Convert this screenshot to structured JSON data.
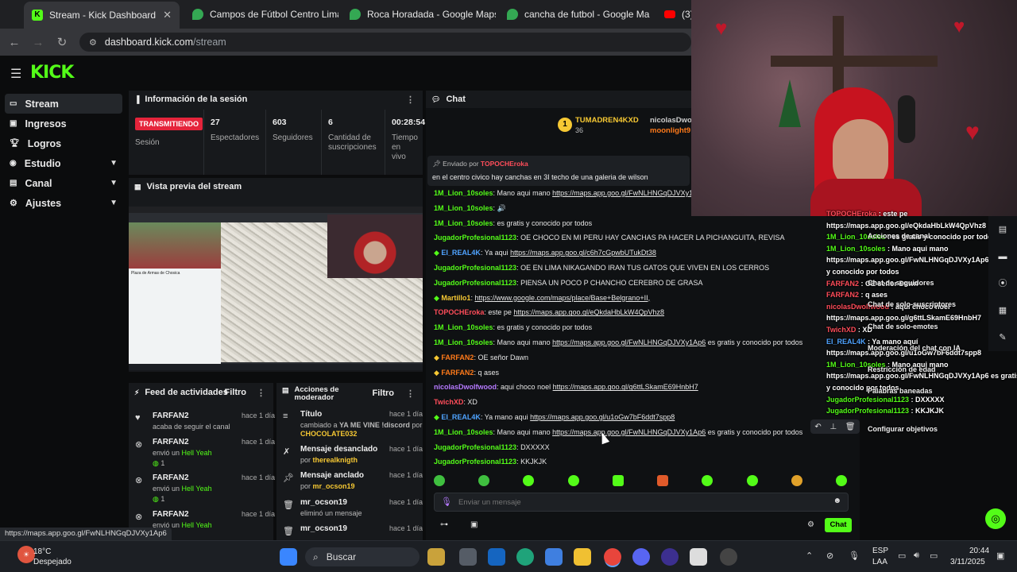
{
  "browser": {
    "tabs": [
      {
        "label": "Stream - Kick Dashboard",
        "active": true,
        "color": "#53fc18"
      },
      {
        "label": "Campos de Fútbol Centro Lima",
        "active": false,
        "color": "#34a853"
      },
      {
        "label": "Roca Horadada - Google Maps",
        "active": false,
        "color": "#34a853"
      },
      {
        "label": "cancha de futbol - Google Ma",
        "active": false,
        "color": "#34a853"
      },
      {
        "label": "(3)",
        "active": false,
        "color": "#ff0000"
      }
    ],
    "url_host": "dashboard.kick.com",
    "url_path": "/stream"
  },
  "kick": {
    "logo": "KICK",
    "sidebar": [
      {
        "label": "Stream",
        "icon": "monitor-icon",
        "active": true
      },
      {
        "label": "Ingresos",
        "icon": "money-icon"
      },
      {
        "label": "Logros",
        "icon": "trophy-icon"
      },
      {
        "label": "Estudio",
        "icon": "studio-icon",
        "chevron": true
      },
      {
        "label": "Canal",
        "icon": "channel-icon",
        "chevron": true
      },
      {
        "label": "Ajustes",
        "icon": "gear-icon",
        "chevron": true
      }
    ],
    "session": {
      "title": "Información de la sesión",
      "live_badge": "TRANSMITIENDO",
      "session_label": "Sesión",
      "viewers": "27",
      "viewers_label": "Espectadores",
      "followers": "603",
      "followers_label": "Seguidores",
      "subs": "6",
      "subs_label": "Cantidad de suscripciones",
      "time": "00:28:54",
      "time_label": "Tiempo en vivo"
    },
    "preview": {
      "title": "Vista previa del stream"
    },
    "feed": {
      "title": "Feed de actividades",
      "filter": "Filtro",
      "items": [
        {
          "name": "FARFAN2",
          "sub": "acaba de seguir el canal",
          "time": "hace 1 día",
          "icon": "heart-icon"
        },
        {
          "name": "FARFAN2",
          "sub_pre": "envió un",
          "sub_hl": "Hell Yeah",
          "count": "1",
          "time": "hace 1 día",
          "icon": "kick-icon"
        },
        {
          "name": "FARFAN2",
          "sub_pre": "envió un",
          "sub_hl": "Hell Yeah",
          "count": "1",
          "time": "hace 1 día",
          "icon": "kick-icon"
        },
        {
          "name": "FARFAN2",
          "sub_pre": "envió un",
          "sub_hl": "Hell Yeah",
          "time": "hace 1 día",
          "icon": "kick-icon"
        }
      ]
    },
    "modactions": {
      "title": "Acciones de moderador",
      "filter": "Filtro",
      "items": [
        {
          "title": "Título",
          "line1_pre": "cambiado a",
          "line1_hl": "YA ME VINE !discord",
          "line2_pre": "por",
          "line2_hl": "CHOCOLATE032",
          "time": "hace 1 día",
          "icon": "title-icon"
        },
        {
          "title": "Mensaje desanclado",
          "line1_pre": "por",
          "line1_hl": "therealknigth",
          "time": "hace 1 día",
          "icon": "unpin-icon"
        },
        {
          "title": "Mensaje anclado",
          "line1_pre": "por",
          "line1_hl": "mr_ocson19",
          "time": "hace 1 día",
          "icon": "pin-icon"
        },
        {
          "title": "mr_ocson19",
          "line1_pre": "eliminó un mensaje",
          "time": "hace 1 día",
          "icon": "trash-icon"
        },
        {
          "title": "mr_ocson19",
          "time": "hace 1 día",
          "icon": "trash-icon"
        }
      ]
    },
    "chat": {
      "title": "Chat",
      "top_user": "TUMADREN4KXD",
      "top_count": "36",
      "top_user2": "nicolasDwol",
      "top_user3": "moonlight9",
      "pinned_label_pre": "Enviado por",
      "pinned_by": "TOPOCHEroka",
      "pinned_text": "en el centro civico hay canchas en 3I techo de una galeria de wilson",
      "messages": [
        {
          "user": "1M_Lion_10soles",
          "color": "c-green",
          "text": "Mano aqui mano",
          "link": "https://maps.app.goo.gl/FwNLHNGqDJVXy1Ap6"
        },
        {
          "user": "1M_Lion_10soles",
          "color": "c-green",
          "text": "🔊"
        },
        {
          "user": "1M_Lion_10soles",
          "color": "c-green",
          "text": "es gratis y conocido por todos"
        },
        {
          "user": "JugadorProfesional1123",
          "color": "c-green",
          "text": "OE CHOCO EN MI PERU HAY CANCHAS PA HACER LA PICHANGUITA, REVISA"
        },
        {
          "user": "EI_REAL4K",
          "color": "c-blue",
          "badge": "c-green",
          "text": "Ya aqui",
          "link": "https://maps.app.goo.gl/c6h7cGpwbUTukDt38"
        },
        {
          "user": "JugadorProfesional1123",
          "color": "c-green",
          "text": "OE EN LIMA NIKAGANDO IRAN TUS GATOS QUE VIVEN EN LOS CERROS"
        },
        {
          "user": "JugadorProfesional1123",
          "color": "c-green",
          "text": "PIENSA UN POCO P CHANCHO CEREBRO DE GRASA"
        },
        {
          "user": "Martillo1",
          "color": "c-yellow",
          "badge": "c-green",
          "text": "",
          "link": "https://www.google.com/maps/place/Base+Belgrano+II,"
        },
        {
          "user": "TOPOCHEroka",
          "color": "c-red",
          "text": "este pe",
          "link": "https://maps.app.goo.gl/eQkdaHbLkW4QpVhz8"
        },
        {
          "user": "1M_Lion_10soles",
          "color": "c-green",
          "text": "es gratis y conocido por todos"
        },
        {
          "user": "1M_Lion_10soles",
          "color": "c-green",
          "text": "Mano aqui mano",
          "link": "https://maps.app.goo.gl/FwNLHNGqDJVXy1Ap6",
          "after": "es gratis y conocido por todos"
        },
        {
          "user": "FARFAN2",
          "color": "c-orange",
          "badge": "c-yellow",
          "text": "OE señor Dawn"
        },
        {
          "user": "FARFAN2",
          "color": "c-orange",
          "badge": "c-yellow",
          "text": "q ases"
        },
        {
          "user": "nicolasDwolfwood",
          "color": "c-purple",
          "text": "aqui choco noel",
          "link": "https://maps.app.goo.gl/g6ttLSkamE69HnbH7"
        },
        {
          "user": "TwichXD",
          "color": "c-red",
          "text": "XD"
        },
        {
          "user": "EI_REAL4K",
          "color": "c-blue",
          "badge": "c-green",
          "text": "Ya mano aqui",
          "link": "https://maps.app.goo.gl/u1oGw7bF6ddt7spp8"
        },
        {
          "user": "1M_Lion_10soles",
          "color": "c-green",
          "text": "Mano aqui mano",
          "link": "https://maps.app.goo.gl/FwNLHNGqDJVXy1Ap6",
          "after": "es gratis y conocido por todos"
        },
        {
          "user": "JugadorProfesional1123",
          "color": "c-green",
          "text": "DXXXXX"
        },
        {
          "user": "JugadorProfesional1123",
          "color": "c-green",
          "text": "KKJKJK"
        }
      ],
      "input_placeholder": "Enviar un mensaje",
      "send_label": "Chat"
    },
    "overlay_chat": [
      {
        "user": "TOPOCHEroka",
        "text": "este pe"
      },
      {
        "user": "",
        "text": "https://maps.app.goo.gl/eQkdaHbLkW4QpVhz8"
      },
      {
        "user": "1M_Lion_10soles",
        "text": "es gratis y conocido por todos"
      },
      {
        "user": "1M_Lion_10soles",
        "text": "Mano aqui mano"
      },
      {
        "user": "",
        "text": "https://maps.app.goo.gl/FwNLHNGqDJVXy1Ap6 es gratis"
      },
      {
        "user": "",
        "text": "y conocido por todos"
      },
      {
        "user": "FARFAN2",
        "text": "OE señor Dawn"
      },
      {
        "user": "FARFAN2",
        "text": "q ases"
      },
      {
        "user": "nicolasDwolfwood",
        "text": "aqui choco noel"
      },
      {
        "user": "",
        "text": "https://maps.app.goo.gl/g6ttLSkamE69HnbH7"
      },
      {
        "user": "TwichXD",
        "text": "XD"
      },
      {
        "user": "EI_REAL4K",
        "text": "Ya mano aquí"
      },
      {
        "user": "",
        "text": "https://maps.app.goo.gl/u1oGw7bF6ddt7spp8"
      },
      {
        "user": "1M_Lion_10soles",
        "text": "Mano aqui mano"
      },
      {
        "user": "",
        "text": "https://maps.app.goo.gl/FwNLHNGqDJVXy1Ap6 es gratis"
      },
      {
        "user": "",
        "text": "y conocido por todos"
      },
      {
        "user": "JugadorProfesional1123",
        "text": "DXXXXX"
      },
      {
        "user": "JugadorProfesional1123",
        "text": "KKJKJK"
      }
    ],
    "mod_menu": [
      "Acciones de canal",
      "Chat de seguidores",
      "Chat de solo-suscriptores",
      "Chat de solo-emotes",
      "Moderación del chat con IA",
      "Restricción de edad",
      "Palabras baneadas",
      "Configurar objetivos"
    ]
  },
  "status_url": "https://maps.app.goo.gl/FwNLHNGqDJVXy1Ap6",
  "taskbar": {
    "weather_temp": "18°C",
    "weather_desc": "Despejado",
    "search_placeholder": "Buscar",
    "lang1": "ESP",
    "lang2": "LAA",
    "time": "20:44",
    "date": "3/11/2025"
  }
}
